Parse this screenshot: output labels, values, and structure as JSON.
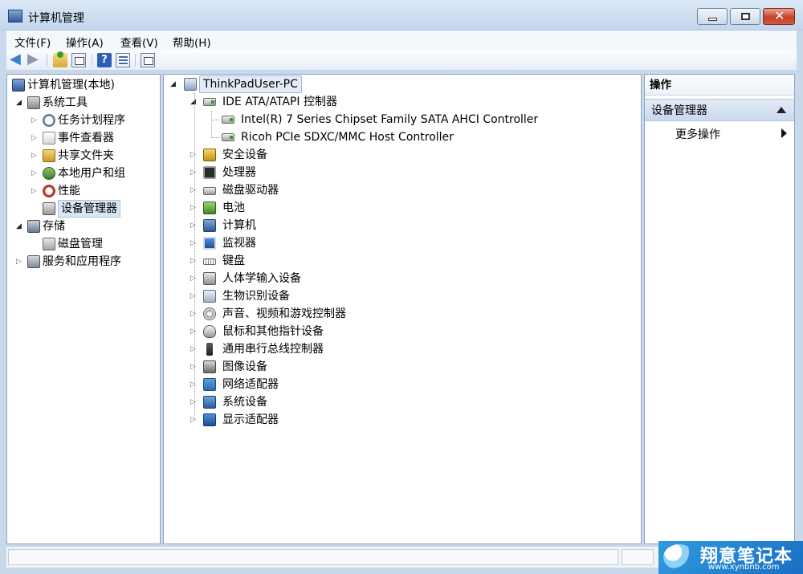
{
  "window": {
    "title": "计算机管理"
  },
  "menubar": [
    "文件(F)",
    "操作(A)",
    "查看(V)",
    "帮助(H)"
  ],
  "left_tree": [
    {
      "label": "计算机管理(本地)",
      "level": 0,
      "expander": "",
      "icon": "computer-management-icon",
      "selected": false
    },
    {
      "label": "系统工具",
      "level": 1,
      "expander": "open",
      "icon": "system-tools-icon",
      "selected": false
    },
    {
      "label": "任务计划程序",
      "level": 2,
      "expander": "closed",
      "icon": "clock-icon",
      "selected": false
    },
    {
      "label": "事件查看器",
      "level": 2,
      "expander": "closed",
      "icon": "event-viewer-icon",
      "selected": false
    },
    {
      "label": "共享文件夹",
      "level": 2,
      "expander": "closed",
      "icon": "shared-folder-icon",
      "selected": false
    },
    {
      "label": "本地用户和组",
      "level": 2,
      "expander": "closed",
      "icon": "users-icon",
      "selected": false
    },
    {
      "label": "性能",
      "level": 2,
      "expander": "closed",
      "icon": "performance-icon",
      "selected": false
    },
    {
      "label": "设备管理器",
      "level": 2,
      "expander": "",
      "icon": "device-manager-icon",
      "selected": true
    },
    {
      "label": "存储",
      "level": 1,
      "expander": "open",
      "icon": "storage-icon",
      "selected": false
    },
    {
      "label": "磁盘管理",
      "level": 2,
      "expander": "",
      "icon": "disk-management-icon",
      "selected": false
    },
    {
      "label": "服务和应用程序",
      "level": 1,
      "expander": "closed",
      "icon": "services-icon",
      "selected": false
    }
  ],
  "device_tree": {
    "host": "ThinkPadUser-PC",
    "categories": [
      {
        "label": "IDE ATA/ATAPI 控制器",
        "icon": "ide-controller-icon",
        "expanded": true,
        "children": [
          "Intel(R) 7 Series Chipset Family SATA AHCI Controller",
          "Ricoh PCIe SDXC/MMC Host Controller"
        ]
      },
      {
        "label": "安全设备",
        "icon": "security-device-icon"
      },
      {
        "label": "处理器",
        "icon": "processor-icon"
      },
      {
        "label": "磁盘驱动器",
        "icon": "disk-drive-icon"
      },
      {
        "label": "电池",
        "icon": "battery-icon"
      },
      {
        "label": "计算机",
        "icon": "computer-icon"
      },
      {
        "label": "监视器",
        "icon": "monitor-icon"
      },
      {
        "label": "键盘",
        "icon": "keyboard-icon"
      },
      {
        "label": "人体学输入设备",
        "icon": "hid-icon"
      },
      {
        "label": "生物识别设备",
        "icon": "biometric-icon"
      },
      {
        "label": "声音、视频和游戏控制器",
        "icon": "audio-icon"
      },
      {
        "label": "鼠标和其他指针设备",
        "icon": "mouse-icon"
      },
      {
        "label": "通用串行总线控制器",
        "icon": "usb-icon"
      },
      {
        "label": "图像设备",
        "icon": "camera-icon"
      },
      {
        "label": "网络适配器",
        "icon": "network-adapter-icon"
      },
      {
        "label": "系统设备",
        "icon": "system-device-icon"
      },
      {
        "label": "显示适配器",
        "icon": "display-adapter-icon"
      }
    ]
  },
  "actions": {
    "header": "操作",
    "section": "设备管理器",
    "more": "更多操作"
  },
  "watermark": {
    "name": "翔意笔记本",
    "url": "www.xynbnb.com"
  }
}
